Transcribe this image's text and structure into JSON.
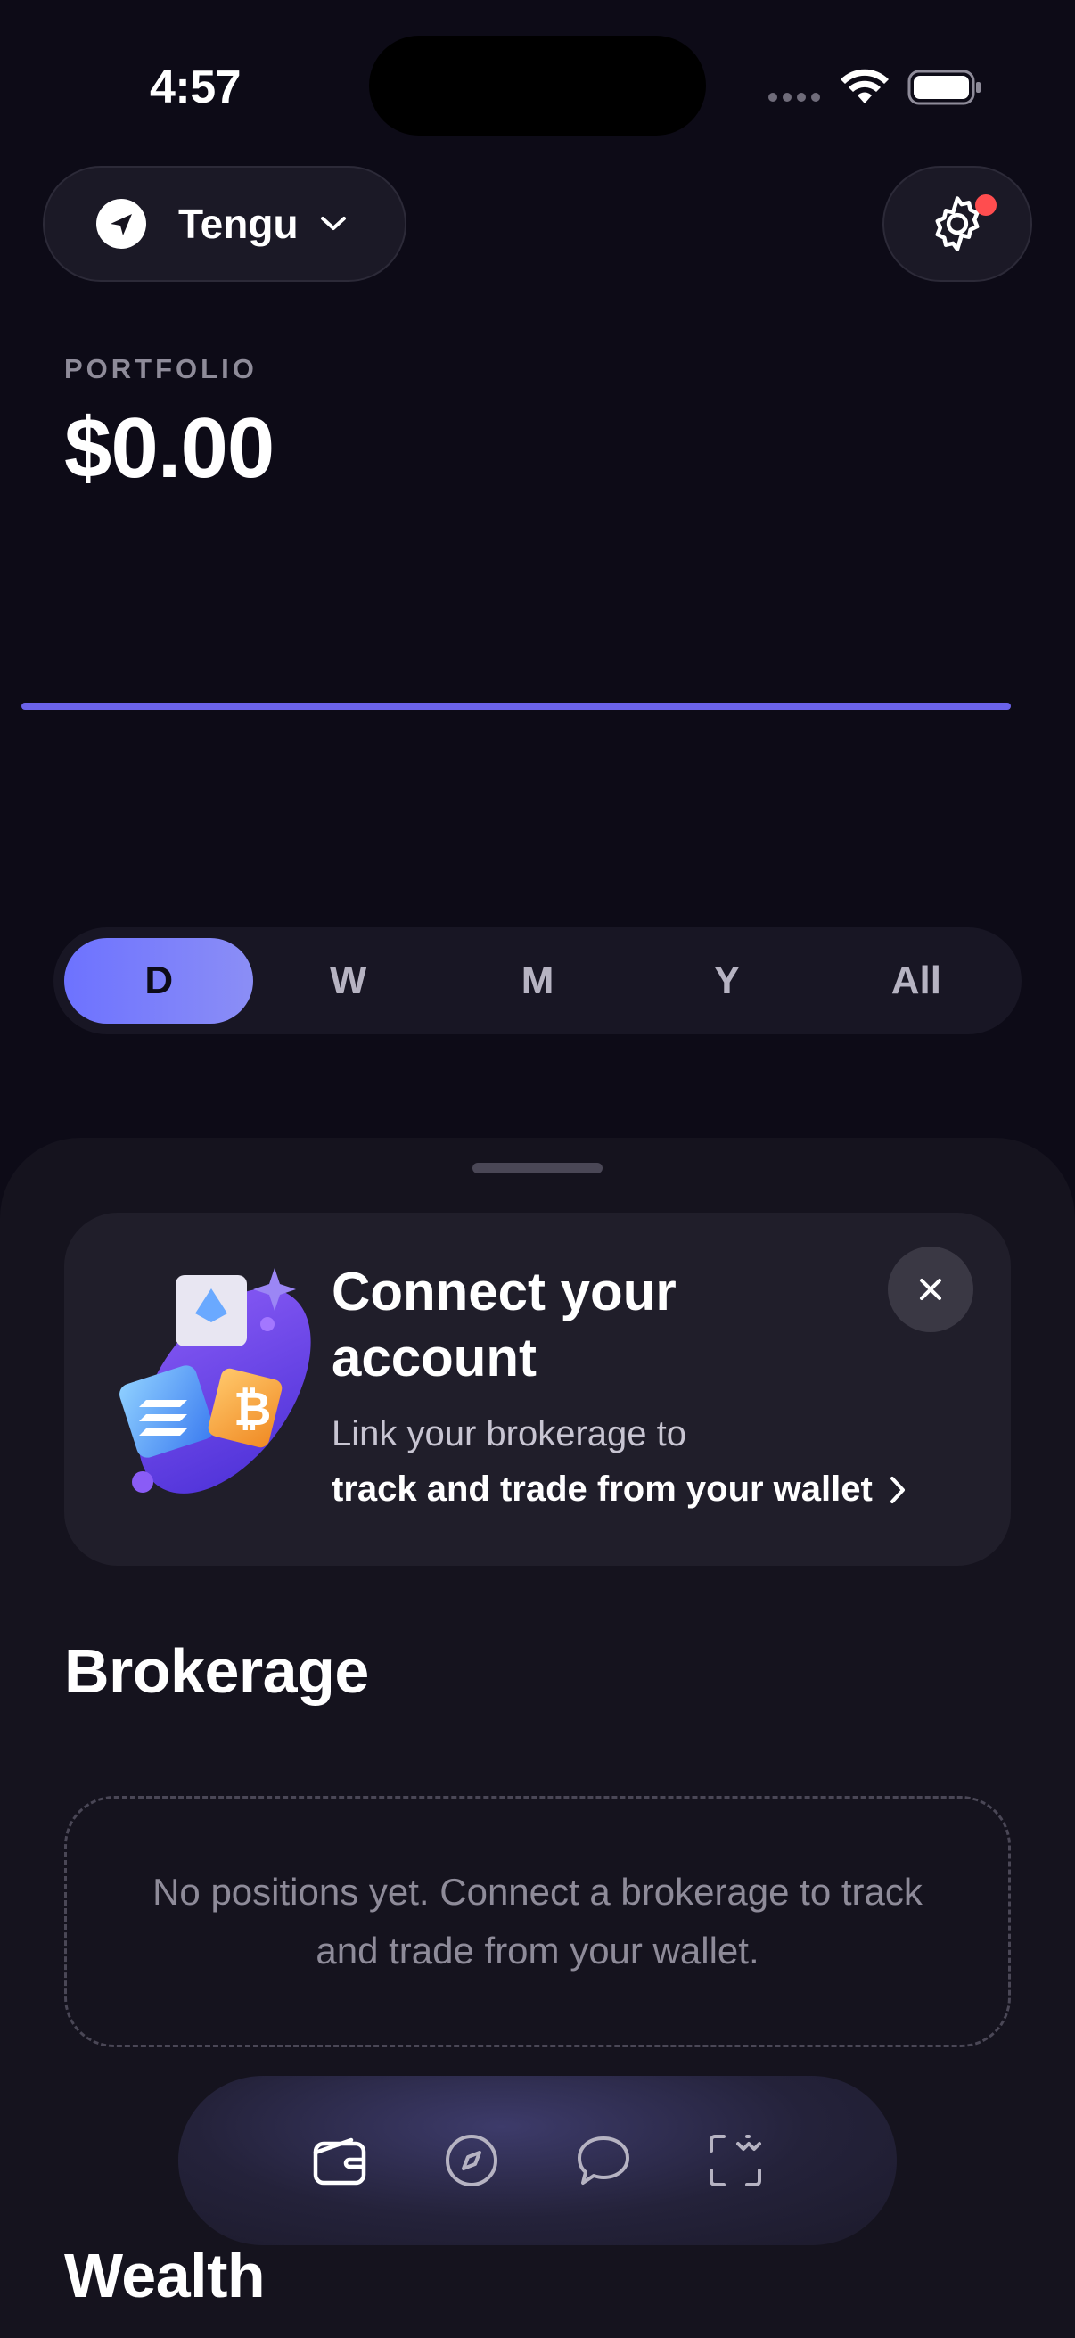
{
  "status_bar": {
    "time": "4:57"
  },
  "header": {
    "account_name": "Tengu"
  },
  "portfolio": {
    "label": "PORTFOLIO",
    "value": "$0.00"
  },
  "range_selector": {
    "options": [
      "D",
      "W",
      "M",
      "Y",
      "All"
    ],
    "selected": "D"
  },
  "connect_card": {
    "title": "Connect your account",
    "subtitle": "Link your brokerage to",
    "link_text": "track and trade from your wallet"
  },
  "brokerage": {
    "title": "Brokerage",
    "empty_message": "No positions yet. Connect a brokerage to track and trade from your wallet."
  },
  "wealth": {
    "title": "Wealth"
  },
  "tabbar": {
    "tabs": [
      "wallet-icon",
      "compass-icon",
      "chat-icon",
      "scan-icon"
    ],
    "active": "wallet-icon"
  },
  "colors": {
    "background": "#0d0b17",
    "accent": "#6d72ff",
    "chart_line": "#6b63ea",
    "badge": "#ff4d4f"
  }
}
